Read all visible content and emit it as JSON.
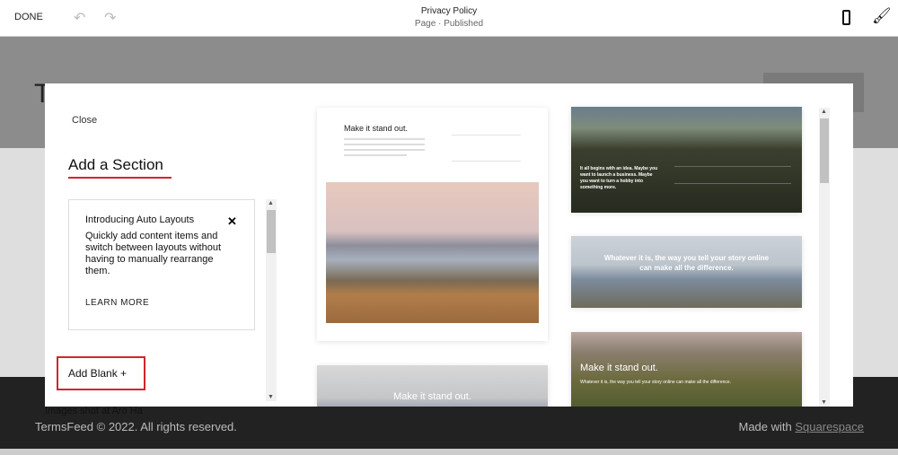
{
  "topbar": {
    "done": "DONE",
    "title": "Privacy Policy",
    "subtitle": "Page · Published",
    "icons": [
      "undo-icon",
      "redo-icon",
      "mobile-preview-icon",
      "paintbrush-icon"
    ]
  },
  "background": {
    "heading_letter": "T"
  },
  "modal": {
    "close": "Close",
    "title": "Add a Section",
    "accent": "#d0262d",
    "promo": {
      "title": "Introducing Auto Layouts",
      "body": "Quickly add content items and switch between layouts without having to manually rearrange them.",
      "link": "LEARN MORE"
    },
    "add_blank": "Add Blank +",
    "templates": {
      "t1_heading": "Make it stand out.",
      "t2_heading": "Make it stand out.",
      "t3_text": "It all begins with an idea. Maybe you want to launch a business. Maybe you want to turn a hobby into something more.",
      "t4_text": "Whatever it is, the way you tell your story online can make all the difference.",
      "t5_heading": "Make it stand out.",
      "t5_text": "Whatever it is, the way you tell your story online can make all the difference."
    }
  },
  "footer": {
    "images_credit": "Images shot at Aro Ha",
    "copyright": "TermsFeed © 2022. All rights reserved.",
    "made_with": "Made with ",
    "brand": "Squarespace"
  }
}
